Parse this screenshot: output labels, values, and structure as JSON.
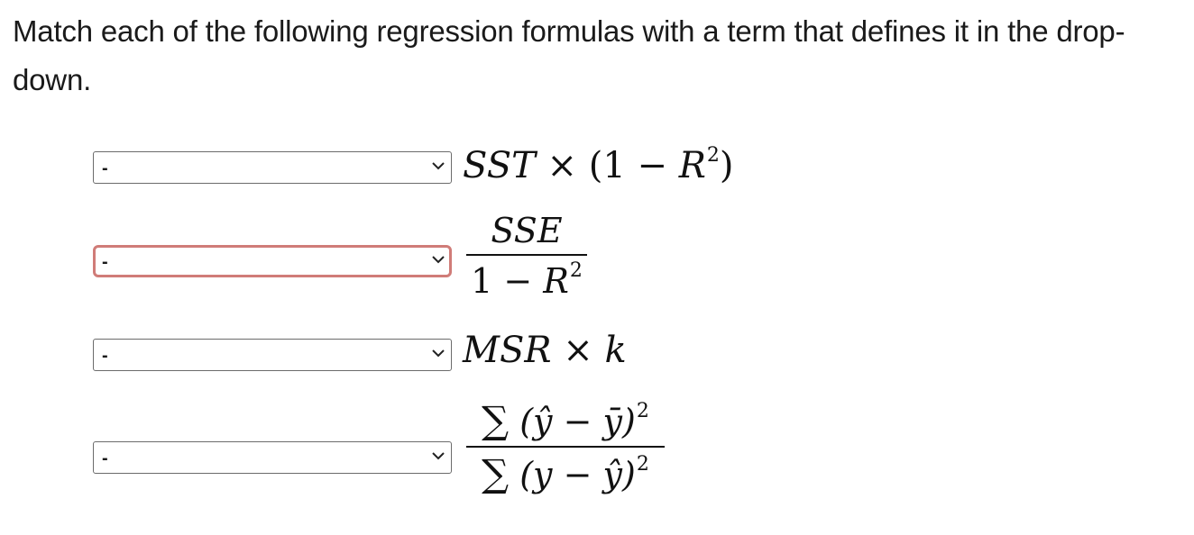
{
  "prompt": "Match each of the following regression formulas with a term that defines it in the drop-down.",
  "dropdowns": [
    {
      "selected": "-",
      "error": false
    },
    {
      "selected": "-",
      "error": true
    },
    {
      "selected": "-",
      "error": false
    },
    {
      "selected": "-",
      "error": false
    }
  ],
  "formulas": {
    "f1": {
      "sst": "SST",
      "times": "×",
      "open": "(1 − ",
      "r": "R",
      "sq": "2",
      "close": ")"
    },
    "f2": {
      "num": "SSE",
      "den_left": "1 − ",
      "r": "R",
      "sq": "2"
    },
    "f3": {
      "msr": "MSR",
      "times": "×",
      "k": "k"
    },
    "f4": {
      "num_sigma": "∑",
      "num_body": "(ŷ − ȳ)",
      "num_sq": "2",
      "den_sigma": "∑",
      "den_body": "(y − ŷ)",
      "den_sq": "2"
    }
  },
  "icons": {
    "dropdown_arrow": "chevron-down-icon"
  },
  "colors": {
    "error_border": "#d07c78",
    "text": "#1a1a1a"
  }
}
